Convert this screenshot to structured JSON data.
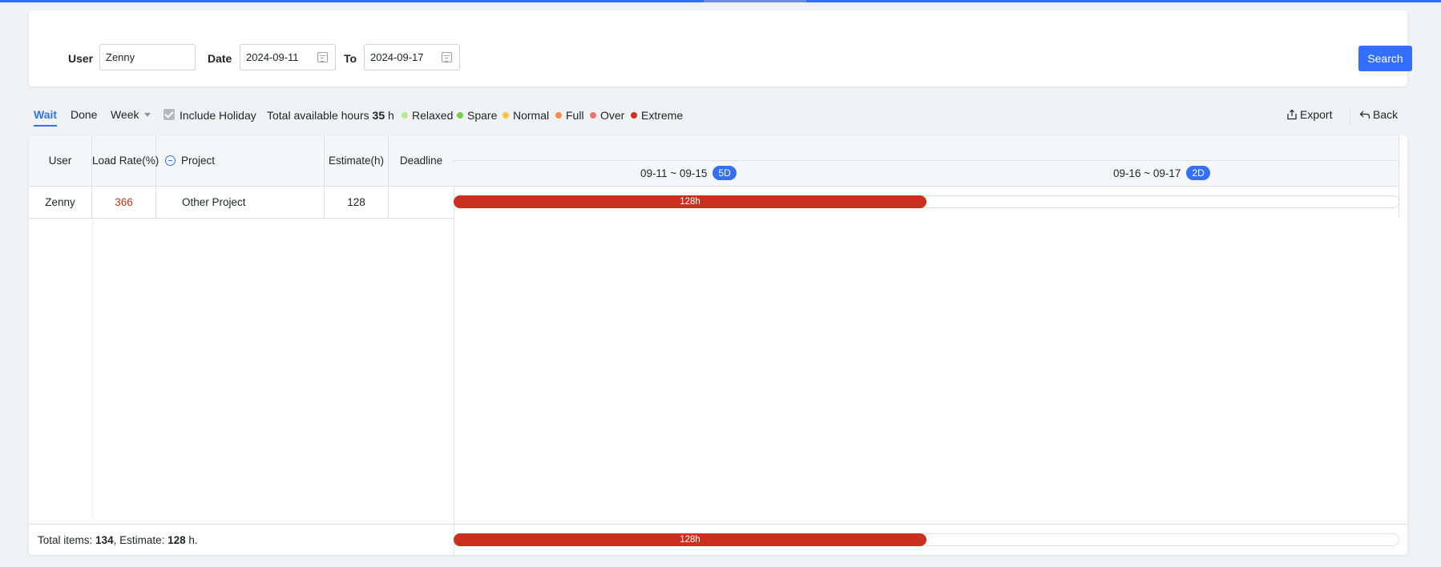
{
  "filter": {
    "user_label": "User",
    "user_value": "Zenny",
    "date_label": "Date",
    "date_from": "2024-09-11",
    "to_label": "To",
    "date_to": "2024-09-17",
    "search_label": "Search"
  },
  "toolbar": {
    "tabs": [
      {
        "label": "Wait",
        "active": true
      },
      {
        "label": "Done",
        "active": false
      }
    ],
    "period_select": "Week",
    "include_holiday_label": "Include Holiday",
    "include_holiday_checked": true,
    "total_hours_prefix": "Total available hours",
    "total_hours_value": "35",
    "total_hours_unit": "h",
    "legend": [
      {
        "label": "Relaxed",
        "color": "#b7eb8f"
      },
      {
        "label": "Spare",
        "color": "#73d13d"
      },
      {
        "label": "Normal",
        "color": "#ffc53d"
      },
      {
        "label": "Full",
        "color": "#fa8c4a"
      },
      {
        "label": "Over",
        "color": "#f0746a"
      },
      {
        "label": "Extreme",
        "color": "#c9301f"
      }
    ],
    "export_label": "Export",
    "back_label": "Back"
  },
  "table": {
    "columns": [
      "User",
      "Load Rate(%)",
      "Project",
      "Estimate(h)",
      "Deadline"
    ],
    "rows": [
      {
        "user": "Zenny",
        "load_rate": "366",
        "project": "Other Project",
        "estimate": "128",
        "deadline": ""
      }
    ]
  },
  "gantt": {
    "periods": [
      {
        "label": "09-11 ~ 09-15",
        "days": "5D"
      },
      {
        "label": "09-16 ~ 09-17",
        "days": "2D"
      }
    ],
    "row_bar_label": "128h",
    "total_bar_label": "128h",
    "bar_color": "#c9301f"
  },
  "footer": {
    "items_prefix": "Total items:",
    "items_value": "134",
    "estimate_prefix": ", Estimate:",
    "estimate_value": "128",
    "estimate_suffix": "h."
  }
}
